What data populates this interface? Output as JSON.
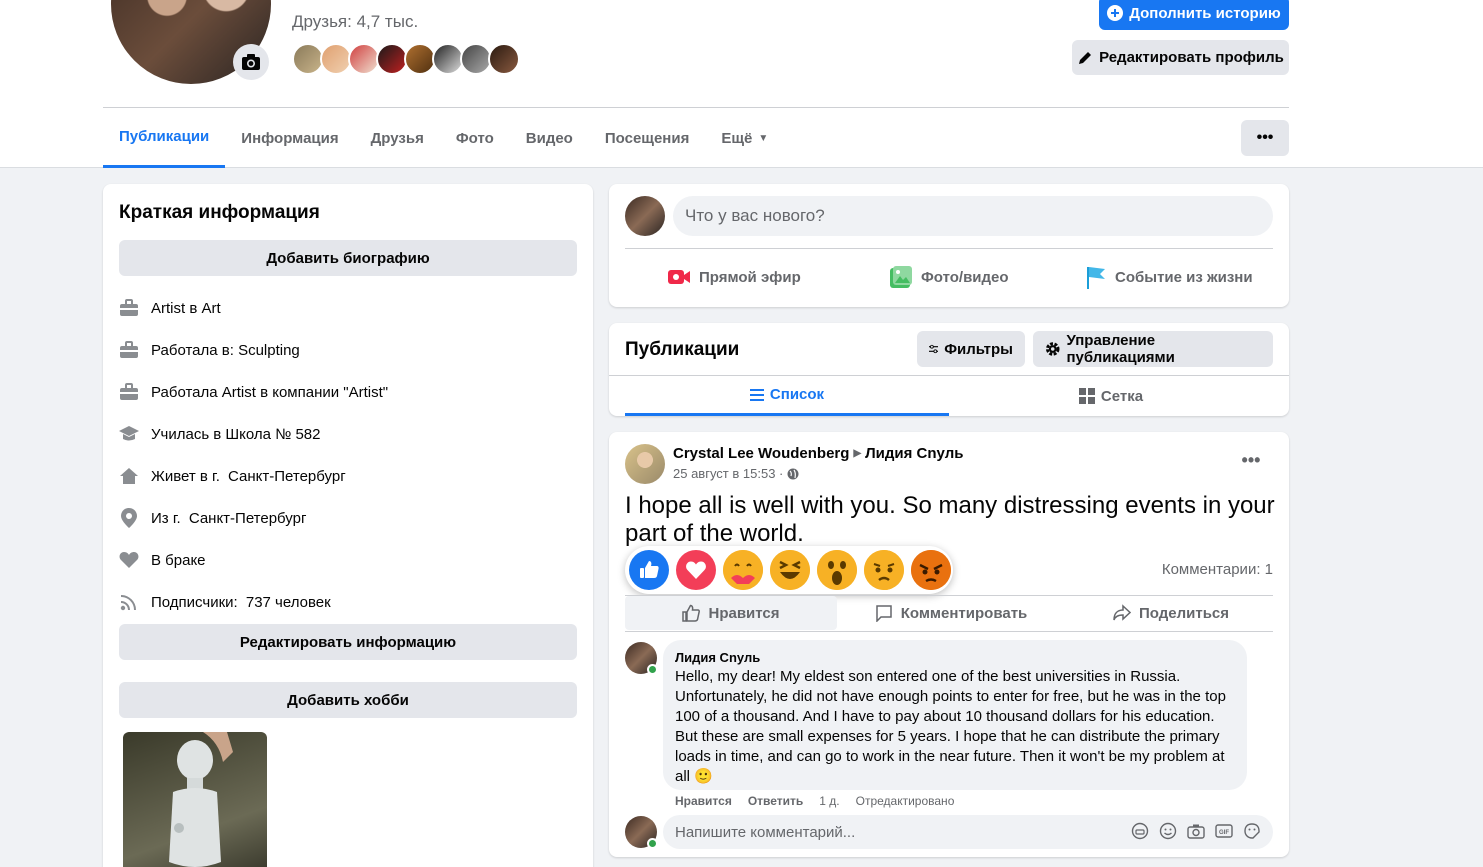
{
  "profile": {
    "friends_count": "Друзья: 4,7 тыс.",
    "add_story": "Дополнить историю",
    "edit_profile": "Редактировать профиль"
  },
  "tabs": [
    {
      "label": "Публикации",
      "active": true
    },
    {
      "label": "Информация"
    },
    {
      "label": "Друзья"
    },
    {
      "label": "Фото"
    },
    {
      "label": "Видео"
    },
    {
      "label": "Посещения"
    },
    {
      "label": "Ещё"
    }
  ],
  "intro": {
    "title": "Краткая информация",
    "add_bio": "Добавить биографию",
    "rows": [
      {
        "icon": "briefcase-icon",
        "text": "Artist в Art",
        "bold": ""
      },
      {
        "icon": "briefcase-icon",
        "text": "Работала в: Sculpting",
        "bold": ""
      },
      {
        "icon": "briefcase-icon",
        "text": "Работала Artist в компании \"Artist\"",
        "bold": ""
      },
      {
        "icon": "graduation-cap-icon",
        "text": "Училась в Школа № 582",
        "bold": ""
      },
      {
        "icon": "home-icon",
        "text": "Живет в г. ",
        "bold": "Санкт-Петербург"
      },
      {
        "icon": "location-pin-icon",
        "text": "Из г. ",
        "bold": "Санкт-Петербург"
      },
      {
        "icon": "heart-icon",
        "text": "В браке",
        "bold": ""
      },
      {
        "icon": "rss-icon",
        "text": "Подписчики: ",
        "bold": "737 человек"
      }
    ],
    "edit_info": "Редактировать информацию",
    "add_hobby": "Добавить хобби"
  },
  "composer": {
    "placeholder": "Что у вас нового?",
    "live": "Прямой эфир",
    "photo": "Фото/видео",
    "life_event": "Событие из жизни"
  },
  "posts_header": {
    "title": "Публикации",
    "filters": "Фильтры",
    "manage": "Управление публикациями",
    "list": "Список",
    "grid": "Сетка"
  },
  "post": {
    "author": "Crystal Lee Woudenberg",
    "target": "Лидия Сnуль",
    "date": "25 август в 15:53 ·",
    "text": "I hope all is well with you. So many distressing events in your part of the world.",
    "comments_count": "Комментарии: 1",
    "like": "Нравится",
    "comment": "Комментировать",
    "share": "Поделиться",
    "reactions": [
      "like",
      "love",
      "care",
      "haha",
      "wow",
      "sad",
      "angry"
    ],
    "reply": {
      "author": "Лидия Сnуль",
      "text": "Hello, my dear! My eldest son entered one of the best universities in Russia. Unfortunately, he did not have enough points to enter for free, but he was in the top 100 of a thousand. And I have to pay about 10 thousand dollars for his education. But these are small expenses for 5 years. I hope that he can distribute the primary loads in time, and can go to work in the near future. Then it won't be my problem at all 🙂",
      "like": "Нравится",
      "answer": "Ответить",
      "time": "1 д.",
      "edited": "Отредактировано"
    },
    "write_comment": "Напишите комментарий..."
  },
  "colors": {
    "accent": "#1877f2",
    "bg": "#f0f2f5",
    "secondary_text": "#65676b"
  }
}
